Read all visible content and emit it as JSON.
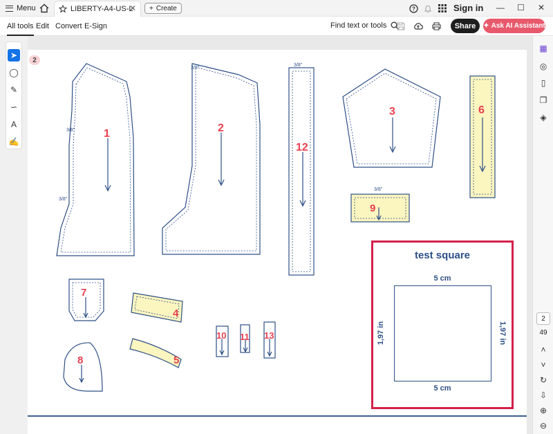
{
  "titlebar": {
    "menu_label": "Menu",
    "tab_title": "LIBERTY-A4-US-LETTER...",
    "create_label": "Create",
    "sign_in": "Sign in"
  },
  "toolbar": {
    "tabs": [
      {
        "label": "All tools",
        "active": true
      },
      {
        "label": "Edit",
        "active": false
      },
      {
        "label": "Convert",
        "active": false
      },
      {
        "label": "E-Sign",
        "active": false
      }
    ],
    "find_tools": "Find text or tools",
    "share_label": "Share",
    "ai_label": "Ask AI Assistant"
  },
  "document": {
    "page_badge": "2",
    "current_page": "2",
    "total_pages": "49",
    "pieces": [
      "1",
      "2",
      "3",
      "4",
      "5",
      "6",
      "7",
      "8",
      "9",
      "10",
      "11",
      "12",
      "13"
    ],
    "seam_label": "3/8\"",
    "test_square": {
      "title": "test square",
      "top_label": "5 cm",
      "bottom_label": "5 cm",
      "left_label": "1,97 in",
      "right_label": "1,97 in"
    }
  },
  "colors": {
    "pattern_line": "#2d4f86",
    "piece_number": "#e8414f",
    "highlight_fill": "#fbf5c0",
    "test_frame": "#d3204a",
    "ai_button": "#e8596c"
  }
}
